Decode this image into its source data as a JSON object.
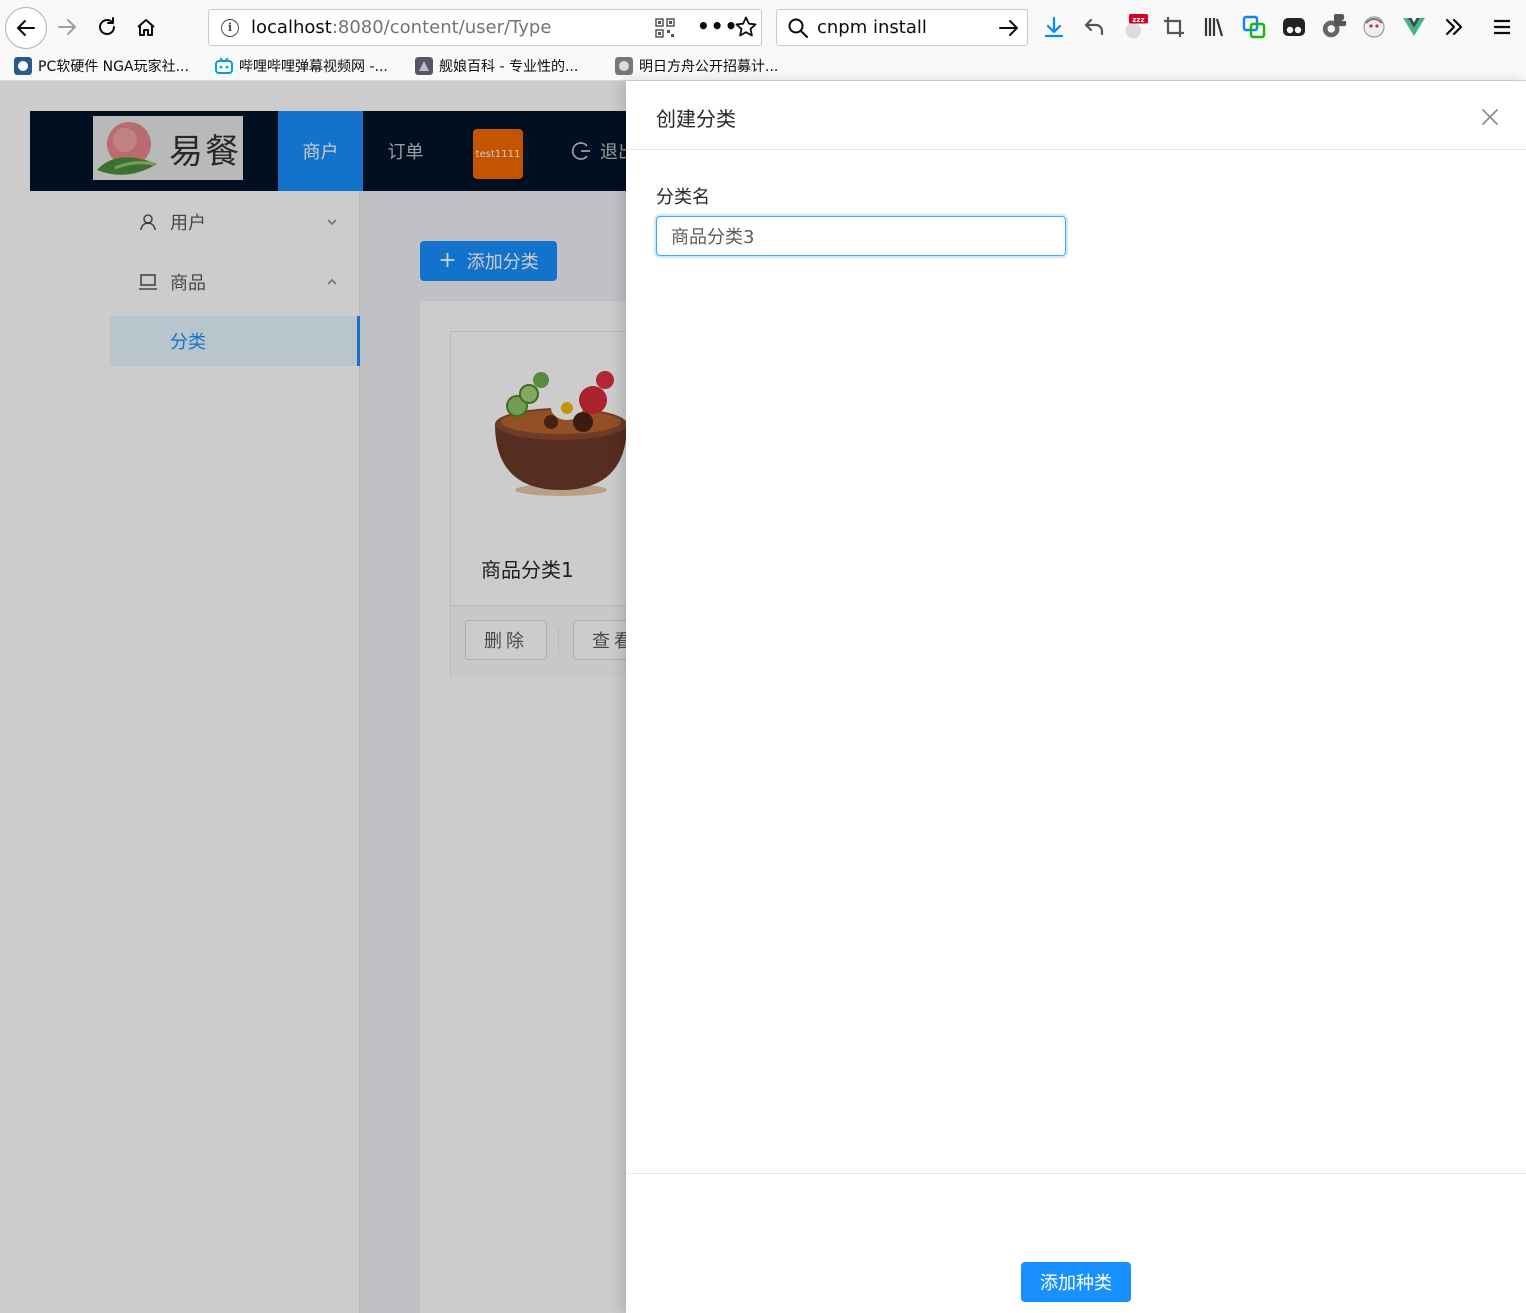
{
  "browser": {
    "url_host": "localhost",
    "url_rest": ":8080/content/user/Type",
    "search_value": "cnpm install",
    "badge_count": "1",
    "bookmarks": [
      {
        "label": "PC软硬件 NGA玩家社..."
      },
      {
        "label": "哔哩哔哩弹幕视频网 -..."
      },
      {
        "label": "舰娘百科 - 专业性的..."
      },
      {
        "label": "明日方舟公开招募计..."
      }
    ]
  },
  "app": {
    "logo_text": "易餐",
    "nav": {
      "merchant": "商户",
      "orders": "订单",
      "user_tag": "test1111",
      "logout": "退出"
    },
    "sidebar": {
      "user": "用户",
      "goods": "商品",
      "category": "分类"
    },
    "add_category_label": "添加分类",
    "card": {
      "title": "商品分类1",
      "delete_label": "删除",
      "view_label": "查看"
    }
  },
  "drawer": {
    "title": "创建分类",
    "field_label": "分类名",
    "field_value": "商品分类3",
    "submit_label": "添加种类"
  }
}
